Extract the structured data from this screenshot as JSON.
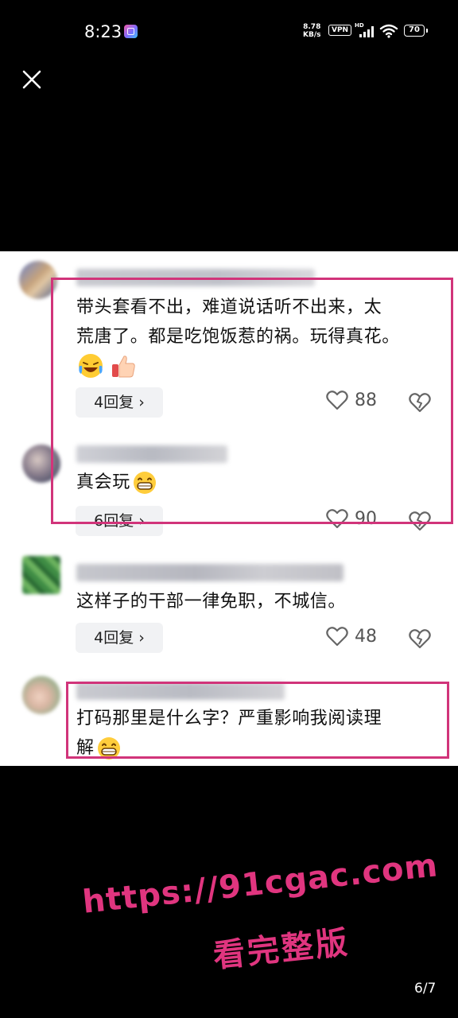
{
  "status_bar": {
    "time": "8:23",
    "net_speed_value": "8.78",
    "net_speed_unit": "KB/s",
    "vpn": "VPN",
    "hd": "HD",
    "battery": "70"
  },
  "comments": [
    {
      "text_line1": "带头套看不出，难道说话听不出来，太",
      "text_line2": "荒唐了。都是吃饱饭惹的祸。玩得真花。",
      "reply_label": "4回复 ›",
      "likes": "88"
    },
    {
      "text": "真会玩",
      "reply_label": "6回复 ›",
      "likes": "90"
    },
    {
      "text": "这样子的干部一律免职，不城信。",
      "reply_label": "4回复 ›",
      "likes": "48"
    },
    {
      "text_line1": "打码那里是什么字？严重影响我阅读理",
      "text_line2": "解"
    }
  ],
  "watermark": {
    "url": "https://91cgac.com",
    "cta": "看完整版"
  },
  "page_indicator": "6/7",
  "colors": {
    "highlight_box": "#d1347a",
    "watermark": "#e0357f",
    "background": "#000000",
    "card": "#ffffff"
  },
  "icons": [
    "close-icon",
    "heart-icon",
    "broken-heart-icon",
    "grinning-emoji",
    "laughing-tears-emoji",
    "thumbs-up-emoji"
  ]
}
